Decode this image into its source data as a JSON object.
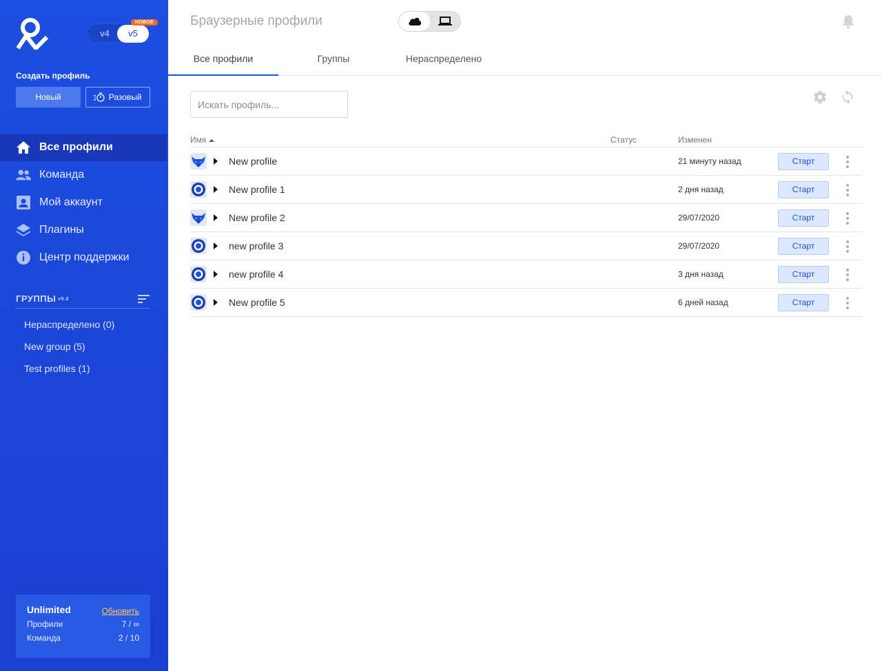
{
  "sidebar": {
    "versions": {
      "v4": "v4",
      "v5": "v5",
      "badge": "НОВОЕ"
    },
    "create_label": "Создать профиль",
    "btn_new": "Новый",
    "btn_oneoff": "Разовый",
    "nav": [
      {
        "label": "Все профили",
        "icon": "home-icon"
      },
      {
        "label": "Команда",
        "icon": "team-icon"
      },
      {
        "label": "Мой аккаунт",
        "icon": "account-icon"
      },
      {
        "label": "Плагины",
        "icon": "layers-icon"
      },
      {
        "label": "Центр поддержки",
        "icon": "info-icon"
      }
    ],
    "groups_title": "ГРУППЫ",
    "groups_version": "v5.0",
    "groups": [
      {
        "label": "Нераспределено",
        "count": "(0)"
      },
      {
        "label": "New group",
        "count": "(5)"
      },
      {
        "label": "Test profiles",
        "count": "(1)"
      }
    ],
    "plan": {
      "name": "Unlimited",
      "upgrade": "Обновить",
      "profiles_label": "Профили",
      "profiles_value": "7 / ∞",
      "team_label": "Команда",
      "team_value": "2 / 10"
    }
  },
  "header": {
    "title": "Браузерные профили",
    "mode": {
      "cloud_icon": "cloud-icon",
      "local_icon": "laptop-icon",
      "selected": "cloud"
    }
  },
  "tabs": [
    "Все профили",
    "Группы",
    "Нераспределено"
  ],
  "search": {
    "placeholder": "Искать профиль..."
  },
  "table": {
    "columns": {
      "name": "Имя",
      "status": "Статус",
      "changed": "Изменен"
    },
    "start_label": "Старт",
    "rows": [
      {
        "browser": "mimic",
        "name": "New profile",
        "changed": "21 минуту назад"
      },
      {
        "browser": "stealthfox",
        "name": "New profile 1",
        "changed": "2 дня назад"
      },
      {
        "browser": "mimic",
        "name": "New profile 2",
        "changed": "29/07/2020"
      },
      {
        "browser": "stealthfox",
        "name": "new profile 3",
        "changed": "29/07/2020"
      },
      {
        "browser": "stealthfox",
        "name": "new profile 4",
        "changed": "3 дня назад"
      },
      {
        "browser": "stealthfox",
        "name": "New profile 5",
        "changed": "6 дней назад"
      }
    ]
  },
  "colors": {
    "sidebar": "#1c46d8",
    "accent": "#1d4fe0",
    "badge": "#ff6b1a",
    "start_button": "#dce8ff"
  }
}
